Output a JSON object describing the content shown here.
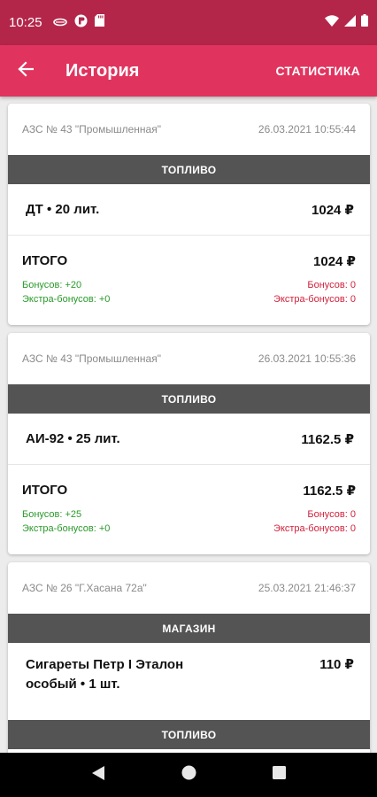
{
  "status_bar": {
    "time": "10:25",
    "icons_left": [
      "infinity-icon",
      "notification-icon",
      "sd-card-icon"
    ],
    "icons_right": [
      "wifi-icon",
      "signal-icon",
      "battery-icon"
    ]
  },
  "app_bar": {
    "title": "История",
    "action_label": "СТАТИСТИКА"
  },
  "colors": {
    "status_bar": "#b3264a",
    "app_bar": "#e0335e",
    "section_bar": "#545454",
    "bonus_positive": "#2a9a2a",
    "bonus_zero": "#d0213b"
  },
  "transactions": [
    {
      "station": "АЗС № 43 \"Промышленная\"",
      "datetime": "26.03.2021 10:55:44",
      "section": "ТОПЛИВО",
      "item_name": "ДТ • 20 лит.",
      "item_price": "1024 ₽",
      "total_label": "ИТОГО",
      "total": "1024 ₽",
      "bonus_earned": "Бонусов: +20",
      "extra_earned": "Экстра-бонусов: +0",
      "bonus_spent": "Бонусов: 0",
      "extra_spent": "Экстра-бонусов: 0"
    },
    {
      "station": "АЗС № 43 \"Промышленная\"",
      "datetime": "26.03.2021 10:55:36",
      "section": "ТОПЛИВО",
      "item_name": "АИ-92 • 25 лит.",
      "item_price": "1162.5 ₽",
      "total_label": "ИТОГО",
      "total": "1162.5 ₽",
      "bonus_earned": "Бонусов: +25",
      "extra_earned": "Экстра-бонусов: +0",
      "bonus_spent": "Бонусов: 0",
      "extra_spent": "Экстра-бонусов: 0"
    },
    {
      "station": "АЗС № 26 \"Г.Хасана 72а\"",
      "datetime": "25.03.2021 21:46:37",
      "section": "МАГАЗИН",
      "item_name_line1": "Сигареты Петр I Эталон",
      "item_name_line2": "особый • 1 шт.",
      "item_price": "110 ₽",
      "section2": "ТОПЛИВО"
    }
  ],
  "nav_bar": {
    "buttons": [
      "back-triangle-icon",
      "home-circle-icon",
      "recents-square-icon"
    ]
  }
}
